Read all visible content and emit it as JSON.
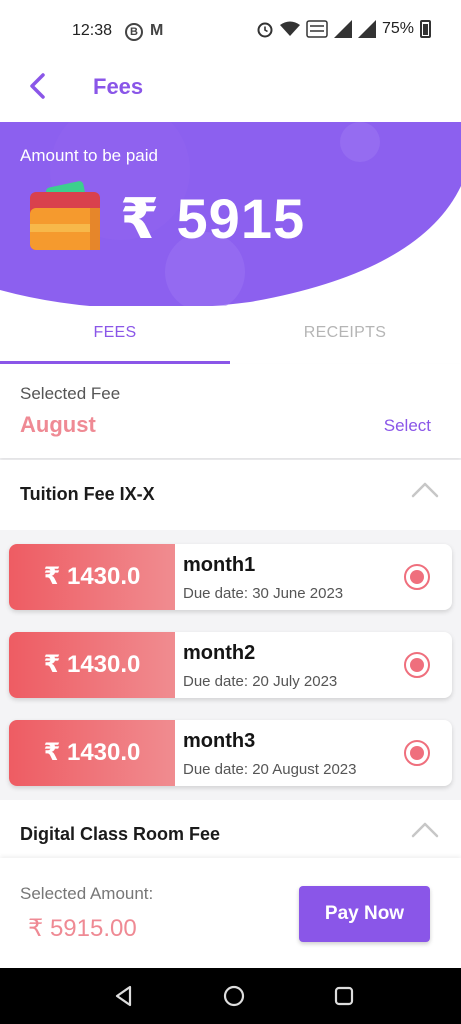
{
  "status_bar": {
    "time": "12:38",
    "b_badge": "B",
    "m_badge": "M",
    "battery": "75%"
  },
  "app_bar": {
    "title": "Fees"
  },
  "hero": {
    "label": "Amount to be paid",
    "amount": "₹ 5915"
  },
  "tabs": [
    {
      "label": "FEES",
      "active": true
    },
    {
      "label": "RECEIPTS",
      "active": false
    }
  ],
  "selected_fee": {
    "label": "Selected Fee",
    "value": "August",
    "action": "Select"
  },
  "groups": [
    {
      "title": "Tuition Fee IX-X",
      "items": [
        {
          "amount": "₹ 1430.0",
          "month": "month1",
          "due": "Due date: 30 June 2023"
        },
        {
          "amount": "₹ 1430.0",
          "month": "month2",
          "due": "Due date: 20 July 2023"
        },
        {
          "amount": "₹ 1430.0",
          "month": "month3",
          "due": "Due date: 20 August 2023"
        }
      ]
    },
    {
      "title": "Digital Class Room Fee",
      "items": []
    }
  ],
  "bottom": {
    "label": "Selected Amount:",
    "value": "₹ 5915.00",
    "button": "Pay Now"
  },
  "colors": {
    "accent": "#8a56e8",
    "pink": "#ef8a94",
    "card_red": "#ee5c63"
  }
}
